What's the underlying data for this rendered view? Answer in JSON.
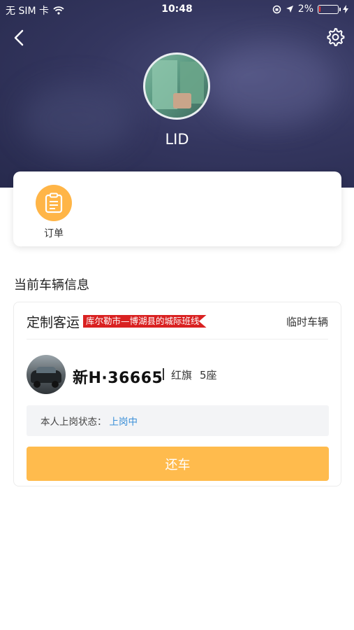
{
  "status_bar": {
    "carrier": "无 SIM 卡",
    "time": "10:48",
    "battery": "2%",
    "battery_level": 0.02
  },
  "header": {
    "back_icon": "chevron-left-icon",
    "settings_icon": "gear-icon",
    "username": "LID"
  },
  "shortcuts": {
    "orders_label": "订单",
    "orders_icon": "clipboard-icon"
  },
  "vehicle_section": {
    "title": "当前车辆信息",
    "service_type": "定制客运",
    "route": "库尔勒市—博湖县的城际班线",
    "vehicle_kind": "临时车辆",
    "plate": "新H·36665",
    "brand": "红旗",
    "seats": "5座",
    "duty_status_label": "本人上岗状态：",
    "duty_status_value": "上岗中",
    "return_button": "还车"
  },
  "colors": {
    "accent_orange": "#ffbb4d",
    "route_tag_red": "#d92121",
    "status_blue": "#3a8fd8",
    "hero_dark": "#2c2e55"
  }
}
